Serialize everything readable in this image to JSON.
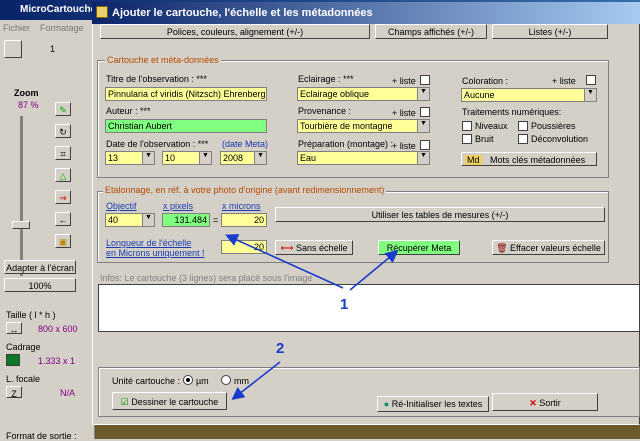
{
  "background_app": {
    "title": "MicroCartouche",
    "menu": [
      "Fichier",
      "Formatage"
    ],
    "tool_number": "1",
    "zoom_label": "Zoom",
    "zoom_value": "87 %",
    "fit_button": "Adapter à l'écran",
    "hundred_button": "100%",
    "size_label": "Taille ( l * h )",
    "size_value": "800 x 600",
    "cadrage_label": "Cadrage",
    "cadrage_value": "1.333 x 1",
    "focal_label": "L. focale",
    "focal_value": "N/A",
    "output_format_label": "Format de sortie :"
  },
  "dialog": {
    "title": "Ajouter le cartouche,  l'échelle et les métadonnées",
    "top_buttons": [
      "Polices, couleurs, alignement  (+/-)",
      "Champs affichés  (+/-)",
      "Listes  (+/-)"
    ],
    "meta_group_title": "Cartouche et méta-données",
    "titre_label": "Titre de l'observation : ***",
    "titre_value": "Pinnularia cf viridis (Nitzsch) Ehrenberg",
    "auteur_label": "Auteur :  ***",
    "auteur_value": "Christian Aubert",
    "date_label": "Date de l'observation : ***",
    "date_meta_label": "(date Meta)",
    "date_day": "13",
    "date_month": "10",
    "date_year": "2008",
    "eclairage_label": "Eclairage : ***",
    "eclairage_value": "Eclairage oblique",
    "provenance_label": "Provenance :",
    "provenance_value": "Tourbière de montagne",
    "preparation_label": "Préparation (montage) :",
    "preparation_value": "Eau",
    "plus_liste": "+ liste",
    "coloration_label": "Coloration :",
    "coloration_value": "Aucune",
    "traitements_label": "Traitements numériques:",
    "traitements": [
      "Niveaux",
      "Poussières",
      "Bruit",
      "Déconvolution"
    ],
    "md_label": "Md",
    "mots_cles_button": "Mots clés métadonnées",
    "scale_group_title": "Etalonnage, en réf. à votre photo d'origine (avant redimensionnement)",
    "objectif_label": "Objectif",
    "objectif_value": "40",
    "xpixels_label": "x pixels",
    "xpixels_value": "131.484",
    "equals": "=",
    "xmicrons_label": "x microns",
    "xmicrons_value": "20",
    "tables_button": "Utiliser les tables de mesures (+/-)",
    "longueur_label_1": "Longueur de l'échelle",
    "longueur_label_2": "en Microns uniquement !",
    "longueur_value": "20",
    "sans_echelle_button": "Sans échelle",
    "recuperer_button": "Récupérer Meta",
    "effacer_button": "Effacer valeurs échelle",
    "infos_label": "Infos: Le cartouche (3 lignes) sera placé sous l'image",
    "unite_label": "Unité cartouche :",
    "unit_um": "µm",
    "unit_mm": "mm",
    "dessiner_button": "Dessiner le cartouche",
    "reinit_button": "Ré-Initialiser les textes",
    "sortir_button": "Sortir"
  },
  "annotations": [
    "1",
    "2"
  ],
  "colors": {
    "accent_yellow": "#ffff99",
    "accent_green": "#80ff80",
    "group_title": "#b34a00",
    "annotation_blue": "#1a3ccc"
  }
}
